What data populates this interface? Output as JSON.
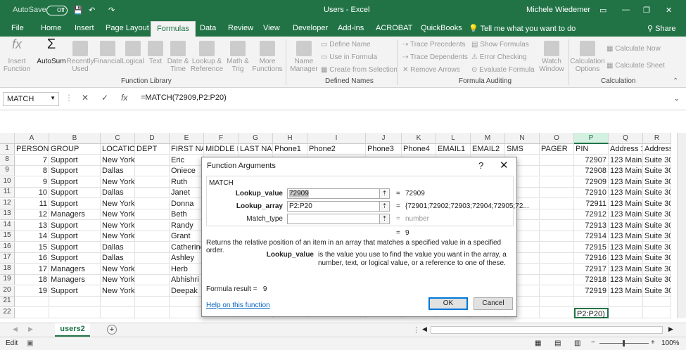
{
  "titlebar": {
    "autosave": "AutoSave",
    "toggle": "Off",
    "doc_title": "Users - Excel",
    "user": "Michele Wiedemer"
  },
  "tabs": [
    {
      "label": "File"
    },
    {
      "label": "Home"
    },
    {
      "label": "Insert"
    },
    {
      "label": "Page Layout"
    },
    {
      "label": "Formulas"
    },
    {
      "label": "Data"
    },
    {
      "label": "Review"
    },
    {
      "label": "View"
    },
    {
      "label": "Developer"
    },
    {
      "label": "Add-ins"
    },
    {
      "label": "ACROBAT"
    },
    {
      "label": "QuickBooks"
    }
  ],
  "tell_me": "Tell me what you want to do",
  "share": "Share",
  "ribbon": {
    "insert_function": "Insert Function",
    "autosum": "AutoSum",
    "recently_used": "Recently Used",
    "financial": "Financial",
    "logical": "Logical",
    "text": "Text",
    "date_time": "Date & Time",
    "lookup": "Lookup & Reference",
    "math": "Math & Trig",
    "more": "More Functions",
    "group_library": "Function Library",
    "name_manager": "Name Manager",
    "define_name": "Define Name",
    "use_in_formula": "Use in Formula",
    "create_from_selection": "Create from Selection",
    "group_names": "Defined Names",
    "trace_precedents": "Trace Precedents",
    "trace_dependents": "Trace Dependents",
    "remove_arrows": "Remove Arrows",
    "show_formulas": "Show Formulas",
    "error_checking": "Error Checking",
    "evaluate_formula": "Evaluate Formula",
    "watch_window": "Watch Window",
    "group_auditing": "Formula Auditing",
    "calc_options": "Calculation Options",
    "calc_now": "Calculate Now",
    "calc_sheet": "Calculate Sheet",
    "group_calc": "Calculation"
  },
  "formula_bar": {
    "name_box": "MATCH",
    "fx": "fx",
    "formula": "=MATCH(72909,P2:P20)"
  },
  "columns": [
    "A",
    "B",
    "C",
    "D",
    "E",
    "F",
    "G",
    "H",
    "I",
    "J",
    "K",
    "L",
    "M",
    "N",
    "O",
    "P",
    "Q",
    "R"
  ],
  "header_row": {
    "num": "1",
    "cells": [
      "PERSON-II",
      "GROUP",
      "LOCATION",
      "DEPT",
      "FIRST NAM",
      "MIDDLE N",
      "LAST NAM",
      "Phone1",
      "Phone2",
      "Phone3",
      "Phone4",
      "EMAIL1",
      "EMAIL2",
      "SMS",
      "PAGER",
      "PIN",
      "Address 1",
      "Address"
    ]
  },
  "rows": [
    {
      "num": "8",
      "a": "7",
      "b": "Support",
      "c": "New York",
      "e": "Eric",
      "p": "72907",
      "q": "123 Main S",
      "r": "Suite 30"
    },
    {
      "num": "9",
      "a": "8",
      "b": "Support",
      "c": "Dallas",
      "e": "Oniece",
      "p": "72908",
      "q": "123 Main S",
      "r": "Suite 30"
    },
    {
      "num": "10",
      "a": "9",
      "b": "Support",
      "c": "New York",
      "e": "Ruth",
      "p": "72909",
      "q": "123 Main S",
      "r": "Suite 30"
    },
    {
      "num": "11",
      "a": "10",
      "b": "Support",
      "c": "Dallas",
      "e": "Janet",
      "p": "72910",
      "q": "123 Main S",
      "r": "Suite 30"
    },
    {
      "num": "12",
      "a": "11",
      "b": "Support",
      "c": "New York",
      "e": "Donna",
      "p": "72911",
      "q": "123 Main S",
      "r": "Suite 30"
    },
    {
      "num": "13",
      "a": "12",
      "b": "Managers",
      "c": "New York",
      "e": "Beth",
      "p": "72912",
      "q": "123 Main S",
      "r": "Suite 30"
    },
    {
      "num": "14",
      "a": "13",
      "b": "Support",
      "c": "New York",
      "e": "Randy",
      "p": "72913",
      "q": "123 Main S",
      "r": "Suite 30"
    },
    {
      "num": "15",
      "a": "14",
      "b": "Support",
      "c": "New York",
      "e": "Grant",
      "p": "72914",
      "q": "123 Main S",
      "r": "Suite 30"
    },
    {
      "num": "16",
      "a": "15",
      "b": "Support",
      "c": "Dallas",
      "e": "Catherine",
      "p": "72915",
      "q": "123 Main S",
      "r": "Suite 30"
    },
    {
      "num": "17",
      "a": "16",
      "b": "Support",
      "c": "Dallas",
      "e": "Ashley",
      "p": "72916",
      "q": "123 Main S",
      "r": "Suite 30"
    },
    {
      "num": "18",
      "a": "17",
      "b": "Managers",
      "c": "New York",
      "e": "Herb",
      "p": "72917",
      "q": "123 Main S",
      "r": "Suite 30"
    },
    {
      "num": "19",
      "a": "18",
      "b": "Managers",
      "c": "New York",
      "e": "Abhishri",
      "p": "72918",
      "q": "123 Main S",
      "r": "Suite 30"
    },
    {
      "num": "20",
      "a": "19",
      "b": "Support",
      "c": "New York",
      "e": "Deepak",
      "p": "72919",
      "q": "123 Main S",
      "r": "Suite 30"
    },
    {
      "num": "21",
      "a": "",
      "b": "",
      "c": "",
      "e": "",
      "p": "",
      "q": "",
      "r": ""
    },
    {
      "num": "22",
      "a": "",
      "b": "",
      "c": "",
      "e": "",
      "p": "P2:P20)",
      "q": "",
      "r": ""
    }
  ],
  "dialog": {
    "title": "Function Arguments",
    "help_q": "?",
    "close": "✕",
    "fn": "MATCH",
    "args": [
      {
        "label": "Lookup_value",
        "value": "72909",
        "result": "72909",
        "bold": true
      },
      {
        "label": "Lookup_array",
        "value": "P2:P20",
        "result": "{72901;72902;72903;72904;72905;72...",
        "bold": true
      },
      {
        "label": "Match_type",
        "value": "",
        "result": "number",
        "bold": false
      }
    ],
    "eq": "=",
    "total": "9",
    "desc": "Returns the relative position of an item in an array that matches a specified value in a specified order.",
    "param_name": "Lookup_value",
    "param_desc": "is the value you use to find the value you want in the array, a number, text, or logical value, or a reference to one of these.",
    "result_label": "Formula result =",
    "result": "9",
    "help": "Help on this function",
    "ok": "OK",
    "cancel": "Cancel"
  },
  "sheet": {
    "tab": "users2",
    "add": "+"
  },
  "status": {
    "mode": "Edit",
    "zoom": "100%"
  }
}
